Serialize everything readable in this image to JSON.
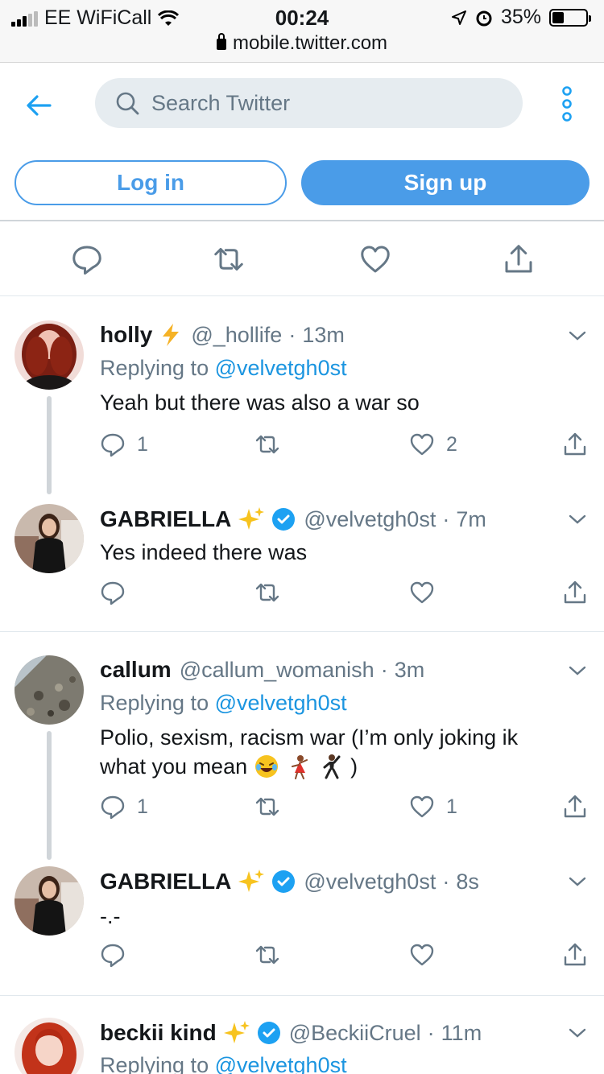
{
  "status_bar": {
    "carrier": "EE WiFiCall",
    "time": "00:24",
    "battery": "35%"
  },
  "browser": {
    "url": "mobile.twitter.com"
  },
  "header": {
    "search_placeholder": "Search Twitter",
    "login_label": "Log in",
    "signup_label": "Sign up"
  },
  "tweets": [
    {
      "name": "holly",
      "handle": "@_hollife",
      "sep": "·",
      "time": "13m",
      "replying_prefix": "Replying to ",
      "replying_to": "@velvetgh0st",
      "text": "Yeah but there was also a war so",
      "reply_count": "1",
      "like_count": "2"
    },
    {
      "name": "GABRIELLA",
      "handle": "@velvetgh0st",
      "sep": "·",
      "time": "7m",
      "text": "Yes indeed there was"
    },
    {
      "name": "callum",
      "handle": "@callum_womanish",
      "sep": "·",
      "time": "3m",
      "replying_prefix": "Replying to ",
      "replying_to": "@velvetgh0st",
      "text_line1": "Polio, sexism, racism war (I’m only joking ik",
      "text_line2": "what you mean",
      "text_end": ")",
      "reply_count": "1",
      "like_count": "1"
    },
    {
      "name": "GABRIELLA",
      "handle": "@velvetgh0st",
      "sep": "·",
      "time": "8s",
      "text": "-.-"
    },
    {
      "name": "beckii kind",
      "handle": "@BeckiiCruel",
      "sep": "·",
      "time": "11m",
      "replying_prefix": "Replying to ",
      "replying_to": "@velvetgh0st"
    }
  ],
  "colors": {
    "accent": "#4a9ce8",
    "link": "#1b95e0",
    "muted": "#657786",
    "verified": "#1da1f2"
  }
}
